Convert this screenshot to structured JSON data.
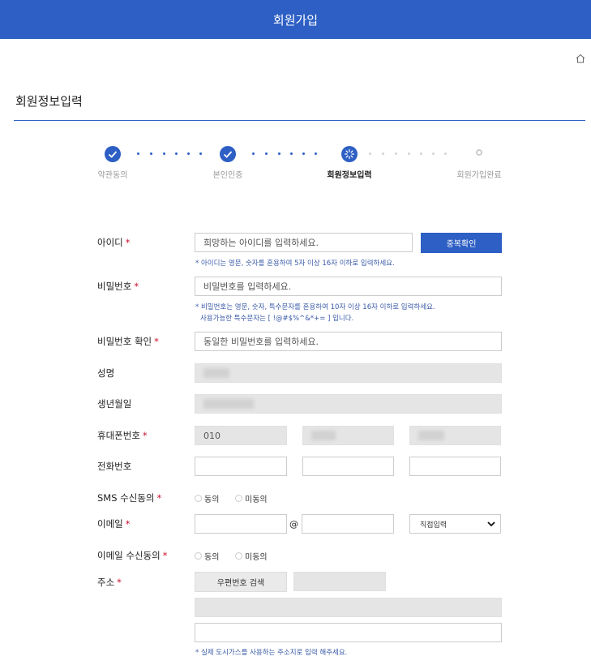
{
  "header": {
    "title": "회원가입"
  },
  "section": {
    "title": "회원정보입력"
  },
  "steps": [
    {
      "label": "약관동의",
      "state": "done"
    },
    {
      "label": "본인인증",
      "state": "done"
    },
    {
      "label": "회원정보입력",
      "state": "current"
    },
    {
      "label": "회원가입완료",
      "state": "pending"
    }
  ],
  "form": {
    "userid": {
      "label": "아이디",
      "placeholder": "희망하는 아이디를 입력하세요.",
      "check_button": "중복확인",
      "hint": "* 아이디는 영문, 숫자를 혼용하여 5자 이상 16자 이하로 입력하세요."
    },
    "password": {
      "label": "비밀번호",
      "placeholder": "비밀번호를 입력하세요.",
      "hint1": "* 비밀번호는 영문, 숫자, 특수문자를 혼용하여 10자 이상 16자 이하로 입력하세요.",
      "hint2": "사용가능한 특수문자는 [ !@#$%^&*+= ] 입니다."
    },
    "password_confirm": {
      "label": "비밀번호 확인",
      "placeholder": "동일한 비밀번호를 입력하세요."
    },
    "name": {
      "label": "성명"
    },
    "birth": {
      "label": "생년월일"
    },
    "mobile": {
      "label": "휴대폰번호",
      "prefix": "010"
    },
    "phone": {
      "label": "전화번호"
    },
    "sms_consent": {
      "label": "SMS 수신동의",
      "agree": "동의",
      "disagree": "미동의"
    },
    "email": {
      "label": "이메일",
      "at": "@",
      "domain_select": "직접입력"
    },
    "email_consent": {
      "label": "이메일 수신동의",
      "agree": "동의",
      "disagree": "미동의"
    },
    "address": {
      "label": "주소",
      "postcode_button": "우편번호 검색",
      "hint": "* 실제 도시가스를 사용하는 주소지로 입력 해주세요."
    },
    "required_mark": "*"
  },
  "colors": {
    "primary": "#2d5fc4",
    "required": "#c8102e",
    "hint": "#3a5ba8"
  }
}
